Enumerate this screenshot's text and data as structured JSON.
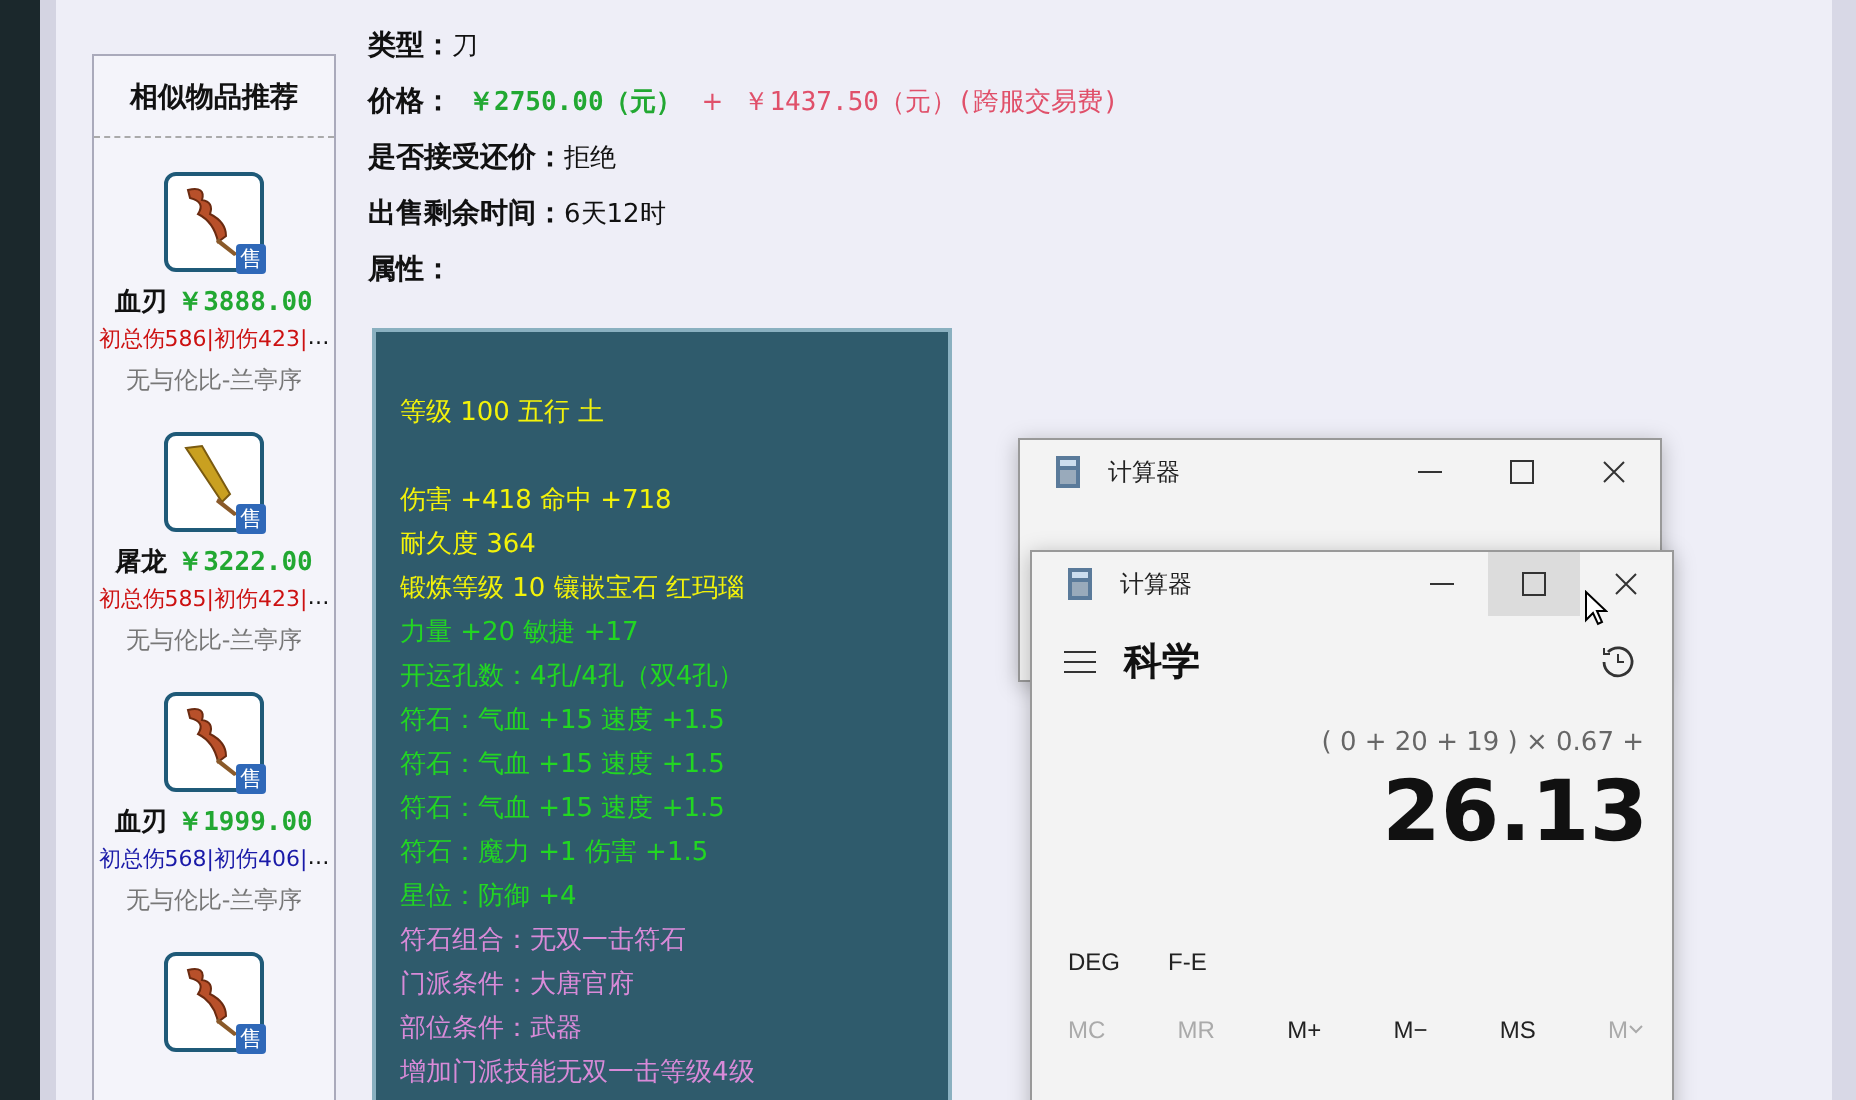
{
  "info_rows": [
    {
      "label": "类型：",
      "value": "刀"
    },
    {
      "label": "价格：",
      "kind": "price",
      "price": "￥2750.00（元）",
      "plus": "+",
      "fee": "￥1437.50（元）(跨服交易费)"
    },
    {
      "label": "是否接受还价：",
      "value": "拒绝"
    },
    {
      "label": "出售剩余时间：",
      "value": "6天12时"
    },
    {
      "label": "属性："
    }
  ],
  "sidebar": {
    "title": "相似物品推荐",
    "items": [
      {
        "kind": "full",
        "name": "血刃",
        "price": "￥3888.00",
        "stats": "初总伤586|初伤423|",
        "more": "…",
        "color": "#cc1111",
        "seller": "无与伦比-兰亭序",
        "badge": "售"
      },
      {
        "kind": "full",
        "name": "屠龙",
        "price": "￥3222.00",
        "stats": "初总伤585|初伤423|",
        "more": "…",
        "color": "#cc1111",
        "seller": "无与伦比-兰亭序",
        "badge": "售"
      },
      {
        "kind": "full",
        "name": "血刃",
        "price": "￥1999.00",
        "stats": "初总伤568|初伤406|",
        "more": "…",
        "color": "#1a1aa8",
        "seller": "无与伦比-兰亭序",
        "badge": "售"
      },
      {
        "kind": "icon",
        "badge": "售"
      }
    ]
  },
  "attributes": [
    [
      {
        "text": "等级 100 五行 土",
        "color": "#f2f20a"
      }
    ],
    [
      {
        "text": "伤害 +418 命中 +718",
        "color": "#f2f20a"
      },
      {
        "text": "耐久度 364",
        "color": "#f2f20a"
      },
      {
        "text": "锻炼等级 10 镶嵌宝石 红玛瑙",
        "color": "#f2f20a"
      },
      {
        "text": "力量 +20 敏捷 +17",
        "color": "#22d622"
      },
      {
        "text": "开运孔数：4孔/4孔（双4孔）",
        "color": "#22d622"
      },
      {
        "text": "符石：气血 +15 速度 +1.5",
        "color": "#22d622"
      },
      {
        "text": "符石：气血 +15 速度 +1.5",
        "color": "#22d622"
      },
      {
        "text": "符石：气血 +15 速度 +1.5",
        "color": "#22d622"
      },
      {
        "text": "符石：魔力 +1 伤害 +1.5",
        "color": "#22d622"
      },
      {
        "text": "星位：防御 +4",
        "color": "#22d622"
      },
      {
        "text": "符石组合：无双一击符石",
        "color": "#d88ad8"
      },
      {
        "text": "门派条件：大唐官府",
        "color": "#d88ad8"
      },
      {
        "text": "部位条件：武器",
        "color": "#d88ad8"
      },
      {
        "text": "增加门派技能无双一击等级4级",
        "color": "#d88ad8"
      }
    ]
  ],
  "calc_back": {
    "title": "计算器"
  },
  "calc": {
    "title": "计算器",
    "mode": "科学",
    "expression": "( 0 + 20 + 19 ) × 0.67 +",
    "result": "26.13",
    "toggles": [
      "DEG",
      "F-E"
    ],
    "memory": [
      {
        "kind": "plain",
        "label": "MC",
        "disabled": true
      },
      {
        "kind": "plain",
        "label": "MR",
        "disabled": true
      },
      {
        "kind": "plain",
        "label": "M+",
        "disabled": false
      },
      {
        "kind": "plain",
        "label": "M−",
        "disabled": false
      },
      {
        "kind": "plain",
        "label": "MS",
        "disabled": false
      },
      {
        "kind": "dropdown",
        "label": "M",
        "disabled": true
      }
    ]
  }
}
